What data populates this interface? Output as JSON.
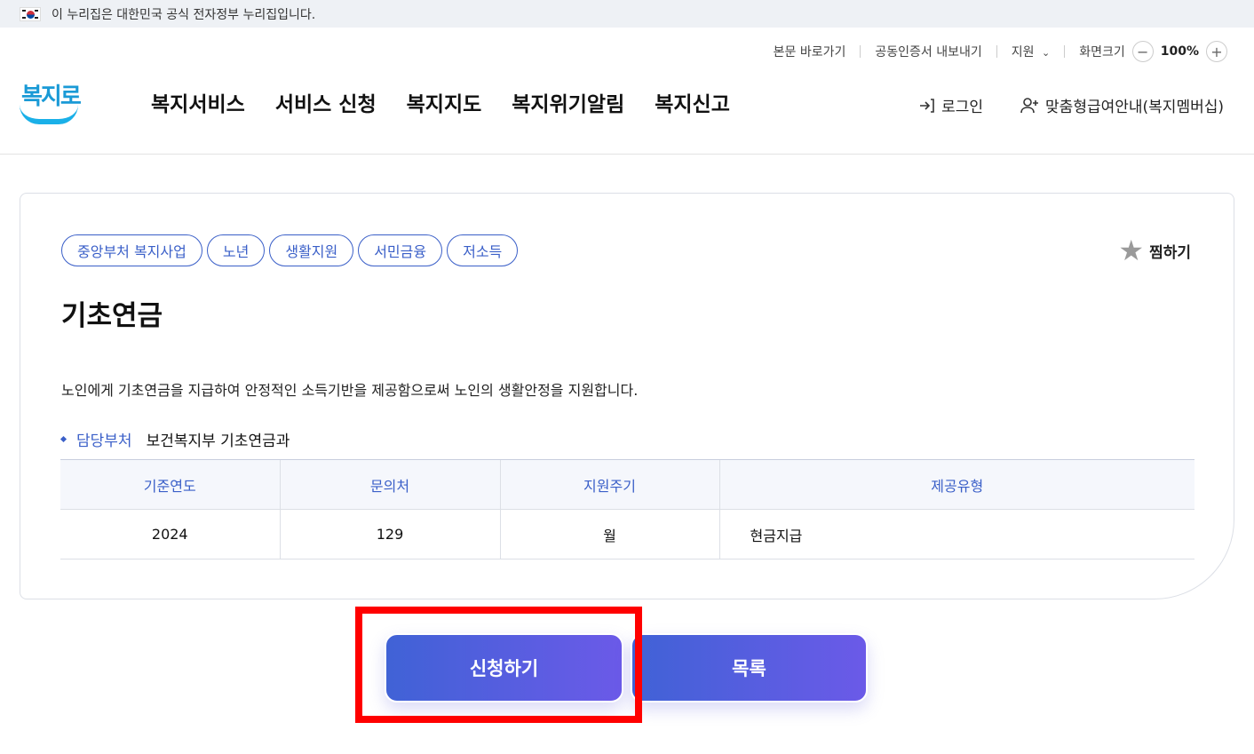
{
  "gov_banner": {
    "text": "이 누리집은 대한민국 공식 전자정부 누리집입니다."
  },
  "util_bar": {
    "skip_to_content": "본문 바로가기",
    "export_cert": "공동인증서 내보내기",
    "support": "지원",
    "screen_size_label": "화면크기",
    "zoom_out": "−",
    "zoom_level": "100%",
    "zoom_in": "+"
  },
  "header": {
    "logo_text": "복지로",
    "nav": [
      "복지서비스",
      "서비스 신청",
      "복지지도",
      "복지위기알림",
      "복지신고"
    ],
    "login": "로그인",
    "membership": "맞춤형급여안내(복지멤버십)"
  },
  "service": {
    "tags": [
      "중앙부처 복지사업",
      "노년",
      "생활지원",
      "서민금융",
      "저소득"
    ],
    "bookmark": "찜하기",
    "title": "기초연금",
    "description": "노인에게 기초연금을 지급하여 안정적인 소득기반을 제공함으로써 노인의 생활안정을 지원합니다.",
    "dept_label": "담당부처",
    "dept_value": "보건복지부 기초연금과",
    "table": {
      "headers": [
        "기준연도",
        "문의처",
        "지원주기",
        "제공유형"
      ],
      "row": [
        "2024",
        "129",
        "월",
        "현금지급"
      ]
    }
  },
  "buttons": {
    "apply": "신청하기",
    "list": "목록"
  }
}
